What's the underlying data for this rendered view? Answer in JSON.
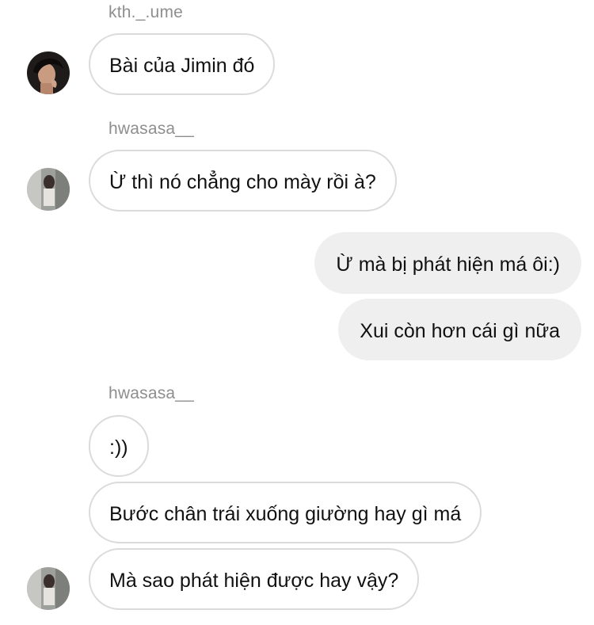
{
  "messages": [
    {
      "sender": "kth._.ume"
    },
    {
      "text": "Bài của Jimin đó"
    },
    {
      "sender": "hwasasa__"
    },
    {
      "text": "Ừ thì nó chẳng cho mày rồi à?"
    },
    {
      "text": "Ừ mà bị phát hiện má ôi:)"
    },
    {
      "text": "Xui còn hơn cái gì nữa"
    },
    {
      "sender": "hwasasa__"
    },
    {
      "text": ":))"
    },
    {
      "text": "Bước chân trái xuống giường hay gì má"
    },
    {
      "text": "Mà sao phát hiện được hay vậy?"
    }
  ]
}
